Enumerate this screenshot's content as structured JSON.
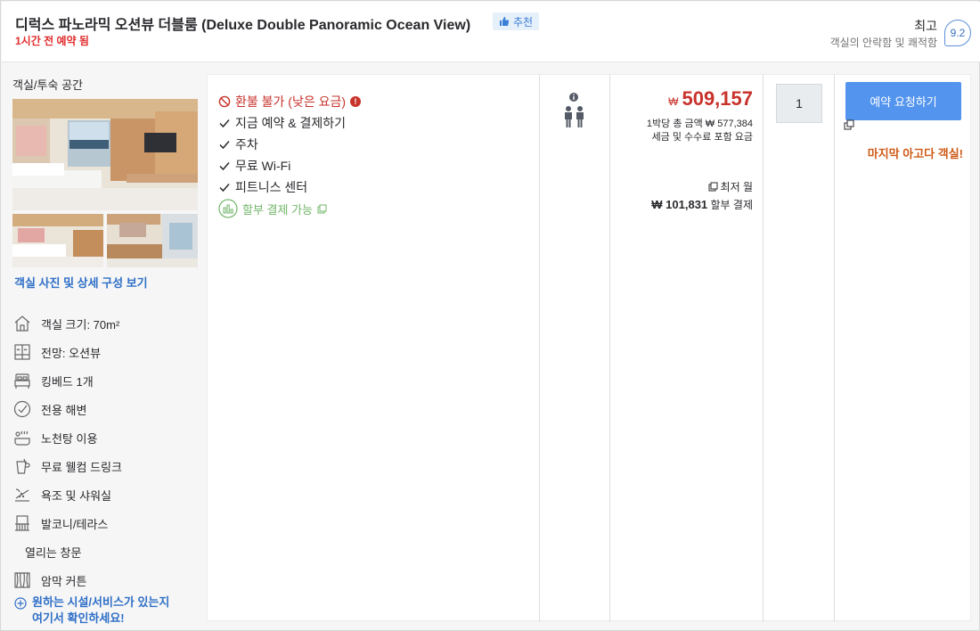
{
  "header": {
    "room_title": "디럭스 파노라믹 오션뷰 더블룸 (Deluxe Double Panoramic Ocean View)",
    "recommend_badge": "추천",
    "booked_recently": "1시간 전 예약 됨",
    "rating_word": "최고",
    "rating_sub": "객실의 안락함 및 쾌적함",
    "rating_score": "9.2"
  },
  "left": {
    "space_label": "객실/투숙 공간",
    "photo_link": "객실 사진 및 상세 구성 보기",
    "features": [
      {
        "icon": "house-icon",
        "label": "객실 크기: 70m²"
      },
      {
        "icon": "window-view-icon",
        "label": "전망: 오션뷰"
      },
      {
        "icon": "bed-icon",
        "label": "킹베드 1개"
      },
      {
        "icon": "check-circle-icon",
        "label": "전용 해변"
      },
      {
        "icon": "hot-tub-icon",
        "label": "노천탕 이용"
      },
      {
        "icon": "cup-icon",
        "label": "무료 웰컴 드링크"
      },
      {
        "icon": "shower-icon",
        "label": "욕조 및 샤워실"
      },
      {
        "icon": "balcony-icon",
        "label": "발코니/테라스"
      },
      {
        "icon": "",
        "label": "열리는 창문"
      },
      {
        "icon": "curtain-icon",
        "label": "암막 커튼"
      }
    ],
    "more_link_line1": "원하는 시설/서비스가 있는지",
    "more_link_line2": "여기서 확인하세요!"
  },
  "conditions": {
    "refund": "환불 불가 (낮은 요금)",
    "items": [
      "지금 예약 & 결제하기",
      "주차",
      "무료 Wi-Fi",
      "피트니스 센터"
    ],
    "installment": "할부 결제 가능"
  },
  "price": {
    "currency": "₩",
    "amount": "509,157",
    "total_label": "1박당 총 금액 ₩ 577,384",
    "tax_label": "세금 및 수수료 포함 요금",
    "monthly_label": "최저 월",
    "monthly_amount": "₩ 101,831",
    "monthly_suffix": "할부 결제"
  },
  "booking": {
    "quantity": "1",
    "book_button": "예약 요청하기",
    "last_room": "마지막 아고다 객실!"
  },
  "colors": {
    "accent_blue": "#5394ef",
    "price_red": "#c8322b",
    "urgent_orange": "#cf5a16",
    "install_green": "#72b56a"
  }
}
